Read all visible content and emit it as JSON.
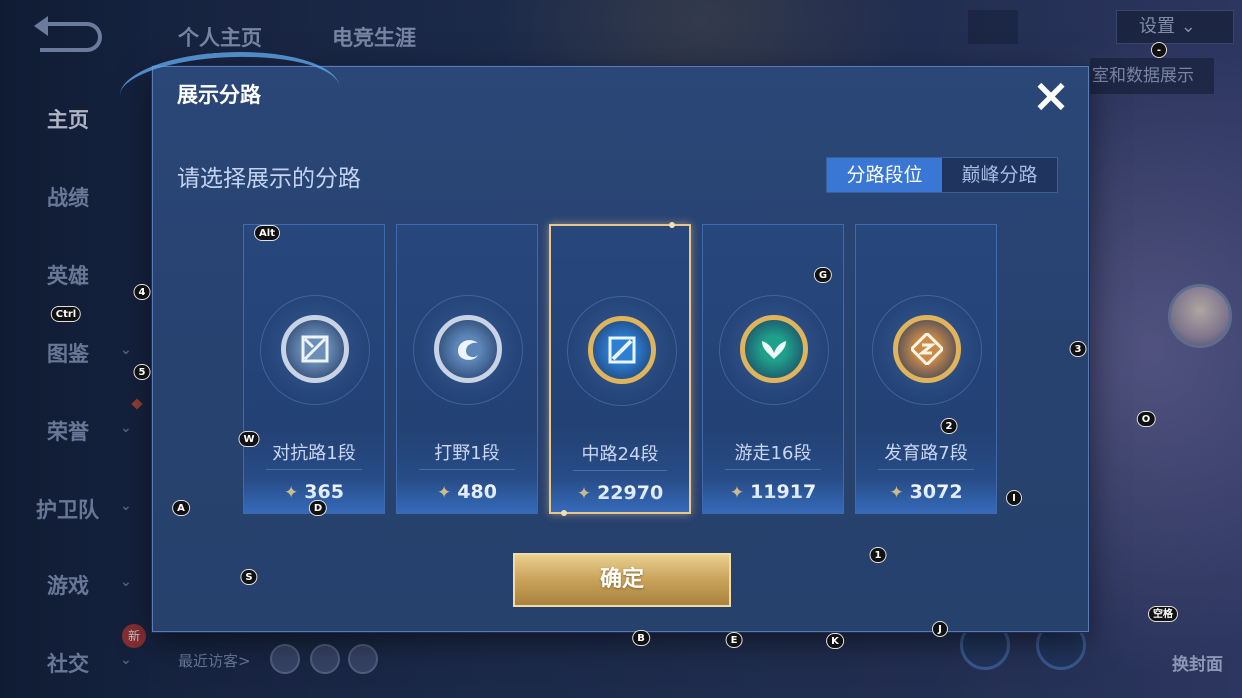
{
  "nav": {
    "items": [
      "主页",
      "战绩",
      "英雄",
      "图鉴",
      "荣誉",
      "护卫队",
      "游戏",
      "社交"
    ],
    "new_badge": "新"
  },
  "top_tabs": [
    "个人主页",
    "电竞生涯"
  ],
  "settings_label": "设置",
  "bg_strip_text": "室和数据展示",
  "visitors_label": "最近访客>",
  "skin_label": "换封面",
  "modal": {
    "title": "展示分路",
    "close_icon": "×",
    "subtitle": "请选择展示的分路",
    "tabs": [
      "分路段位",
      "巅峰分路"
    ],
    "active_tab": 0,
    "confirm_label": "确定"
  },
  "lanes": [
    {
      "name": "对抗路1段",
      "score": "365",
      "icon": "clash-lane-emblem",
      "ring": "#c9d3e3",
      "fill": "#6c8fb8",
      "selected": false
    },
    {
      "name": "打野1段",
      "score": "480",
      "icon": "jungle-dragon-emblem",
      "ring": "#c9d3e3",
      "fill": "#5d86b8",
      "selected": false
    },
    {
      "name": "中路24段",
      "score": "22970",
      "icon": "mid-lane-emblem",
      "ring": "#e0b45a",
      "fill": "#2d7fd6",
      "selected": true
    },
    {
      "name": "游走16段",
      "score": "11917",
      "icon": "roam-wings-emblem",
      "ring": "#e0b45a",
      "fill": "#1fa08a",
      "selected": false
    },
    {
      "name": "发育路7段",
      "score": "3072",
      "icon": "farm-lane-emblem",
      "ring": "#e0b45a",
      "fill": "#c98a4a",
      "selected": false
    }
  ],
  "score_icon": "honor-coin-icon",
  "key_hints": [
    "Alt",
    "4",
    "Ctrl",
    "5",
    "W",
    "A",
    "D",
    "S",
    "G",
    "3",
    "2",
    "O",
    "I",
    "1",
    "B",
    "E",
    "K",
    "J",
    "空格",
    "-"
  ]
}
